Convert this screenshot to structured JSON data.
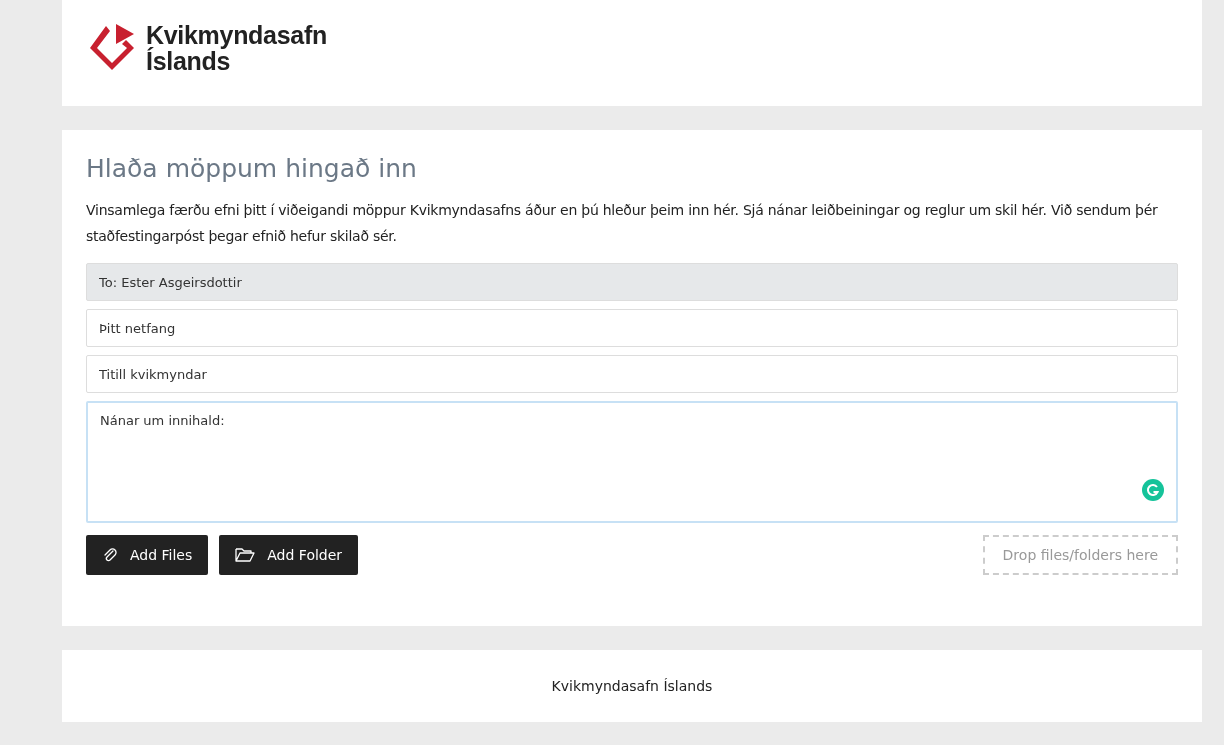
{
  "logo": {
    "lines": [
      "Kvikmyndasafn",
      "Íslands"
    ]
  },
  "form": {
    "title": "Hlaða möppum hingað inn",
    "intro": "Vinsamlega færðu efni þitt í viðeigandi möppur Kvikmyndasafns áður en þú hleður þeim inn hér. Sjá nánar leiðbeiningar og reglur um skil hér. Við sendum þér staðfestingarpóst þegar efnið hefur skilað sér.",
    "fields": [
      {
        "kind": "input",
        "value": "To: Ester Asgeirsdottir",
        "disabled": true,
        "focused": false
      },
      {
        "kind": "input",
        "placeholder": "Þitt netfang",
        "disabled": false,
        "focused": false
      },
      {
        "kind": "input",
        "placeholder": "Titill kvikmyndar",
        "disabled": false,
        "focused": false
      },
      {
        "kind": "textarea",
        "placeholder": "Nánar um innihald:",
        "disabled": false,
        "focused": true
      }
    ],
    "buttons": [
      {
        "kind": "files",
        "label": "Add Files"
      },
      {
        "kind": "folder",
        "label": "Add Folder"
      }
    ],
    "drop_zone": "Drop files/folders here"
  },
  "footer": "Kvikmyndasafn Íslands"
}
